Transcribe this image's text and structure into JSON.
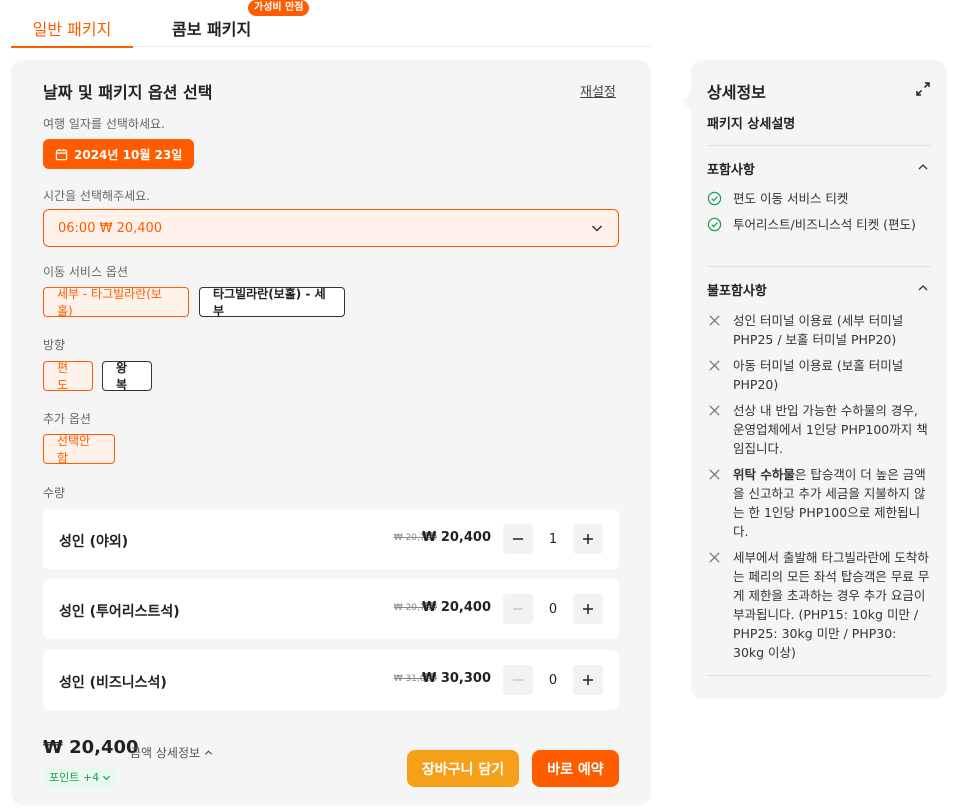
{
  "tabs": [
    {
      "label": "일반 패키지"
    },
    {
      "label": "콤보 패키지",
      "badge": "가성비 만점"
    }
  ],
  "form": {
    "title": "날짜 및 패키지 옵션 선택",
    "reset": "재설정",
    "date_label": "여행 일자를 선택하세요.",
    "date_value": "2024년 10월 23일",
    "time_label": "시간을 선택해주세요.",
    "time_value": "06:00 ₩ 20,400",
    "service_label": "이동 서비스 옵션",
    "service_options": [
      "세부 - 타그빌라란(보홀)",
      "타그빌라란(보홀) - 세부"
    ],
    "direction_label": "방향",
    "direction_options": [
      "편도",
      "왕복"
    ],
    "extra_label": "추가 옵션",
    "extra_options": [
      "선택안함"
    ],
    "qty_label": "수량",
    "qty_rows": [
      {
        "name": "성인 (야외)",
        "old_price": "₩ 20,700",
        "price": "₩ 20,400",
        "qty": "1"
      },
      {
        "name": "성인 (투어리스트석)",
        "old_price": "₩ 20,700",
        "price": "₩ 20,400",
        "qty": "0"
      },
      {
        "name": "성인 (비즈니스석)",
        "old_price": "₩ 31,000",
        "price": "₩ 30,300",
        "qty": "0"
      }
    ],
    "total": "₩ 20,400",
    "total_detail": "금액 상세정보",
    "points": "포인트 +4",
    "cart_button": "장바구니 담기",
    "book_button": "바로 예약"
  },
  "side": {
    "title": "상세정보",
    "subtitle": "패키지 상세설명",
    "included_title": "포함사항",
    "included": [
      "편도 이동 서비스 티켓",
      "투어리스트/비즈니스석 티켓 (편도)"
    ],
    "excluded_title": "불포함사항",
    "excluded": [
      {
        "bold": "",
        "text": "성인 터미널 이용료 (세부 터미널 PHP25 / 보홀 터미널 PHP20)"
      },
      {
        "bold": "",
        "text": "아동 터미널 이용료 (보홀 터미널 PHP20)"
      },
      {
        "bold": "",
        "text": "선상 내 반입 가능한 수하물의 경우, 운영업체에서 1인당 PHP100까지 책임집니다."
      },
      {
        "bold": "위탁 수하물",
        "text": "은 탑승객이 더 높은 금액을 신고하고 추가 세금을 지불하지 않는 한 1인당 PHP100으로 제한됩니다."
      },
      {
        "bold": "",
        "text": "세부에서 출발해 타그빌라란에 도착하는 페리의 모든 좌석 탑승객은 무료 무게 제한을 초과하는 경우 추가 요금이 부과됩니다. (PHP15: 10kg 미만 / PHP25: 30kg 미만 / PHP30: 30kg 이상)"
      }
    ]
  },
  "colors": {
    "accent": "#ff5c00",
    "cart": "#f6a01a",
    "check": "#1a9e54"
  },
  "icons": [
    "calendar-icon",
    "chevron-down-icon",
    "minus-icon",
    "plus-icon",
    "expand-icon",
    "chevron-up-icon",
    "check-circle-icon",
    "x-icon"
  ]
}
